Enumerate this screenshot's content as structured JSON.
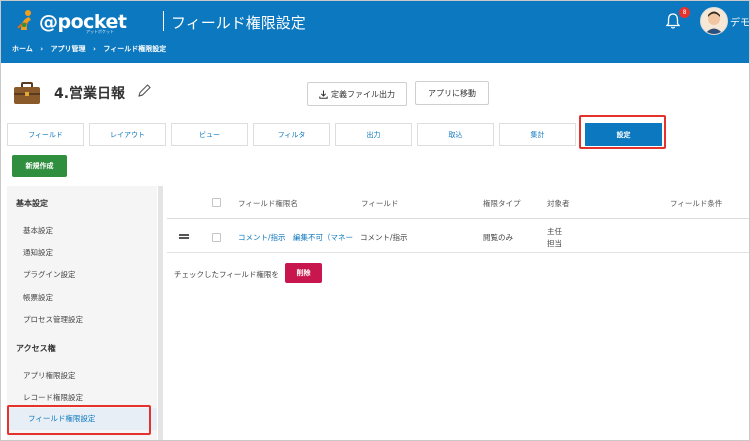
{
  "header": {
    "logo_text": "@pocket",
    "logo_subtext": "アットポケット",
    "page_title": "フィールド権限設定",
    "breadcrumb": [
      "ホーム",
      "アプリ管理",
      "フィールド権限設定"
    ],
    "breadcrumb_sep": "›",
    "notification_count": "8",
    "user_name": "デモ"
  },
  "app": {
    "name": "4.営業日報",
    "export_button": "定義ファイル出力",
    "go_app_button": "アプリに移動"
  },
  "tabs": [
    {
      "label": "フィールド"
    },
    {
      "label": "レイアウト"
    },
    {
      "label": "ビュー"
    },
    {
      "label": "フィルタ"
    },
    {
      "label": "出力"
    },
    {
      "label": "取込"
    },
    {
      "label": "集計"
    },
    {
      "label": "設定",
      "active": true
    }
  ],
  "new_button": "新規作成",
  "sidebar": {
    "sections": [
      {
        "heading": "基本設定",
        "items": [
          "基本設定",
          "通知設定",
          "プラグイン設定",
          "帳票設定",
          "プロセス管理設定"
        ]
      },
      {
        "heading": "アクセス権",
        "items": [
          "アプリ権限設定",
          "レコード権限設定",
          "フィールド権限設定"
        ]
      }
    ],
    "active_item": "フィールド権限設定"
  },
  "table": {
    "columns": [
      "フィールド権限名",
      "フィールド",
      "権限タイプ",
      "対象者",
      "フィールド条件"
    ],
    "rows": [
      {
        "name": "コメント/指示　編集不可（マネー",
        "field": "コメント/指示",
        "type": "閲覧のみ",
        "target": [
          "主任",
          "担当"
        ],
        "condition": ""
      }
    ]
  },
  "bulk_action": {
    "label": "チェックしたフィールド権限を",
    "delete_button": "削除"
  },
  "colors": {
    "header_blue": "#0c78bf",
    "new_button_green": "#2f8f3e",
    "delete_button": "#c8174f",
    "highlight_red": "#e5322d"
  }
}
